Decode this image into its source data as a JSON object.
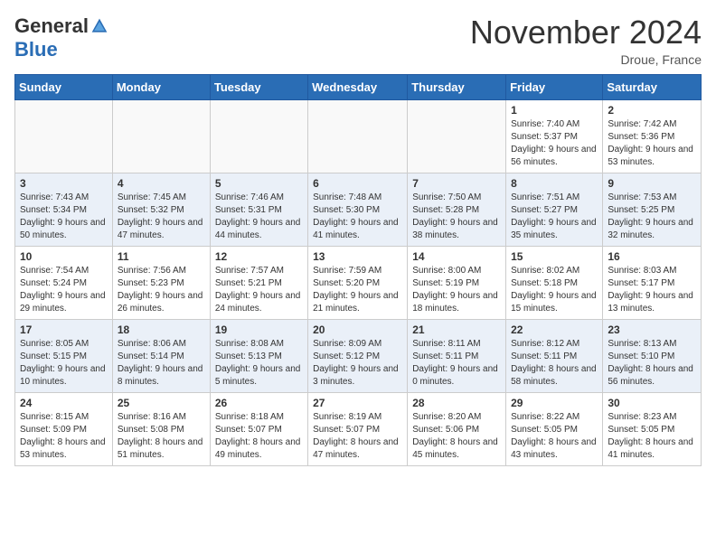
{
  "header": {
    "logo_general": "General",
    "logo_blue": "Blue",
    "month": "November 2024",
    "location": "Droue, France"
  },
  "days_of_week": [
    "Sunday",
    "Monday",
    "Tuesday",
    "Wednesday",
    "Thursday",
    "Friday",
    "Saturday"
  ],
  "weeks": [
    [
      {
        "day": "",
        "info": ""
      },
      {
        "day": "",
        "info": ""
      },
      {
        "day": "",
        "info": ""
      },
      {
        "day": "",
        "info": ""
      },
      {
        "day": "",
        "info": ""
      },
      {
        "day": "1",
        "info": "Sunrise: 7:40 AM\nSunset: 5:37 PM\nDaylight: 9 hours and 56 minutes."
      },
      {
        "day": "2",
        "info": "Sunrise: 7:42 AM\nSunset: 5:36 PM\nDaylight: 9 hours and 53 minutes."
      }
    ],
    [
      {
        "day": "3",
        "info": "Sunrise: 7:43 AM\nSunset: 5:34 PM\nDaylight: 9 hours and 50 minutes."
      },
      {
        "day": "4",
        "info": "Sunrise: 7:45 AM\nSunset: 5:32 PM\nDaylight: 9 hours and 47 minutes."
      },
      {
        "day": "5",
        "info": "Sunrise: 7:46 AM\nSunset: 5:31 PM\nDaylight: 9 hours and 44 minutes."
      },
      {
        "day": "6",
        "info": "Sunrise: 7:48 AM\nSunset: 5:30 PM\nDaylight: 9 hours and 41 minutes."
      },
      {
        "day": "7",
        "info": "Sunrise: 7:50 AM\nSunset: 5:28 PM\nDaylight: 9 hours and 38 minutes."
      },
      {
        "day": "8",
        "info": "Sunrise: 7:51 AM\nSunset: 5:27 PM\nDaylight: 9 hours and 35 minutes."
      },
      {
        "day": "9",
        "info": "Sunrise: 7:53 AM\nSunset: 5:25 PM\nDaylight: 9 hours and 32 minutes."
      }
    ],
    [
      {
        "day": "10",
        "info": "Sunrise: 7:54 AM\nSunset: 5:24 PM\nDaylight: 9 hours and 29 minutes."
      },
      {
        "day": "11",
        "info": "Sunrise: 7:56 AM\nSunset: 5:23 PM\nDaylight: 9 hours and 26 minutes."
      },
      {
        "day": "12",
        "info": "Sunrise: 7:57 AM\nSunset: 5:21 PM\nDaylight: 9 hours and 24 minutes."
      },
      {
        "day": "13",
        "info": "Sunrise: 7:59 AM\nSunset: 5:20 PM\nDaylight: 9 hours and 21 minutes."
      },
      {
        "day": "14",
        "info": "Sunrise: 8:00 AM\nSunset: 5:19 PM\nDaylight: 9 hours and 18 minutes."
      },
      {
        "day": "15",
        "info": "Sunrise: 8:02 AM\nSunset: 5:18 PM\nDaylight: 9 hours and 15 minutes."
      },
      {
        "day": "16",
        "info": "Sunrise: 8:03 AM\nSunset: 5:17 PM\nDaylight: 9 hours and 13 minutes."
      }
    ],
    [
      {
        "day": "17",
        "info": "Sunrise: 8:05 AM\nSunset: 5:15 PM\nDaylight: 9 hours and 10 minutes."
      },
      {
        "day": "18",
        "info": "Sunrise: 8:06 AM\nSunset: 5:14 PM\nDaylight: 9 hours and 8 minutes."
      },
      {
        "day": "19",
        "info": "Sunrise: 8:08 AM\nSunset: 5:13 PM\nDaylight: 9 hours and 5 minutes."
      },
      {
        "day": "20",
        "info": "Sunrise: 8:09 AM\nSunset: 5:12 PM\nDaylight: 9 hours and 3 minutes."
      },
      {
        "day": "21",
        "info": "Sunrise: 8:11 AM\nSunset: 5:11 PM\nDaylight: 9 hours and 0 minutes."
      },
      {
        "day": "22",
        "info": "Sunrise: 8:12 AM\nSunset: 5:11 PM\nDaylight: 8 hours and 58 minutes."
      },
      {
        "day": "23",
        "info": "Sunrise: 8:13 AM\nSunset: 5:10 PM\nDaylight: 8 hours and 56 minutes."
      }
    ],
    [
      {
        "day": "24",
        "info": "Sunrise: 8:15 AM\nSunset: 5:09 PM\nDaylight: 8 hours and 53 minutes."
      },
      {
        "day": "25",
        "info": "Sunrise: 8:16 AM\nSunset: 5:08 PM\nDaylight: 8 hours and 51 minutes."
      },
      {
        "day": "26",
        "info": "Sunrise: 8:18 AM\nSunset: 5:07 PM\nDaylight: 8 hours and 49 minutes."
      },
      {
        "day": "27",
        "info": "Sunrise: 8:19 AM\nSunset: 5:07 PM\nDaylight: 8 hours and 47 minutes."
      },
      {
        "day": "28",
        "info": "Sunrise: 8:20 AM\nSunset: 5:06 PM\nDaylight: 8 hours and 45 minutes."
      },
      {
        "day": "29",
        "info": "Sunrise: 8:22 AM\nSunset: 5:05 PM\nDaylight: 8 hours and 43 minutes."
      },
      {
        "day": "30",
        "info": "Sunrise: 8:23 AM\nSunset: 5:05 PM\nDaylight: 8 hours and 41 minutes."
      }
    ]
  ]
}
